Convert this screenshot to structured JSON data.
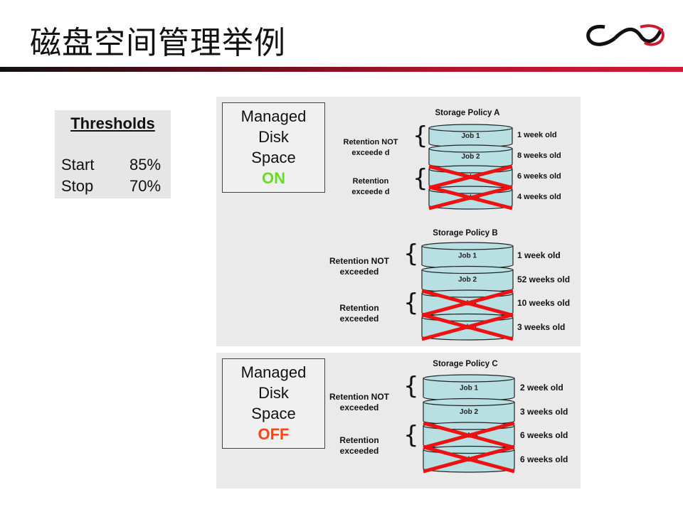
{
  "title": "磁盘空间管理举例",
  "logo": {
    "text": "CV"
  },
  "thresholds": {
    "heading": "Thresholds",
    "rows": [
      {
        "label": "Start",
        "value": "85%"
      },
      {
        "label": "Stop",
        "value": "70%"
      }
    ]
  },
  "colors": {
    "on": "#66dd22",
    "off": "#ff4411",
    "cylinder": "#b8dfe2",
    "cross": "#ee1111"
  },
  "panels": [
    {
      "managed": {
        "lines": [
          "Managed",
          "Disk",
          "Space"
        ],
        "state": "ON"
      },
      "policies": [
        {
          "title": "Storage Policy A",
          "not_label": "Retention NOT exceede d",
          "exc_label": "Retention exceede d",
          "jobs": [
            {
              "name": "Job 1",
              "age": "1 week old",
              "crossed": false
            },
            {
              "name": "Job 2",
              "age": "8 weeks old",
              "crossed": false
            },
            {
              "name": "Job 3",
              "age": "6 weeks old",
              "crossed": true
            },
            {
              "name": "Job 4",
              "age": "4 weeks old",
              "crossed": true
            }
          ]
        },
        {
          "title": "Storage Policy B",
          "not_label": "Retention NOT exceeded",
          "exc_label": "Retention exceeded",
          "jobs": [
            {
              "name": "Job 1",
              "age": "1 week old",
              "crossed": false
            },
            {
              "name": "Job 2",
              "age": "52 weeks old",
              "crossed": false
            },
            {
              "name": "Job 3",
              "age": "10 weeks old",
              "crossed": true
            },
            {
              "name": "Job 4",
              "age": "3 weeks old",
              "crossed": true
            }
          ]
        }
      ]
    },
    {
      "managed": {
        "lines": [
          "Managed",
          "Disk",
          "Space"
        ],
        "state": "OFF"
      },
      "policies": [
        {
          "title": "Storage Policy C",
          "not_label": "Retention NOT exceeded",
          "exc_label": "Retention exceeded",
          "jobs": [
            {
              "name": "Job 1",
              "age": "2 week old",
              "crossed": false
            },
            {
              "name": "Job 2",
              "age": "3 weeks old",
              "crossed": false
            },
            {
              "name": "Job 3",
              "age": "6 weeks old",
              "crossed": true
            },
            {
              "name": "Job 4",
              "age": "6 weeks old",
              "crossed": true
            }
          ]
        }
      ]
    }
  ]
}
